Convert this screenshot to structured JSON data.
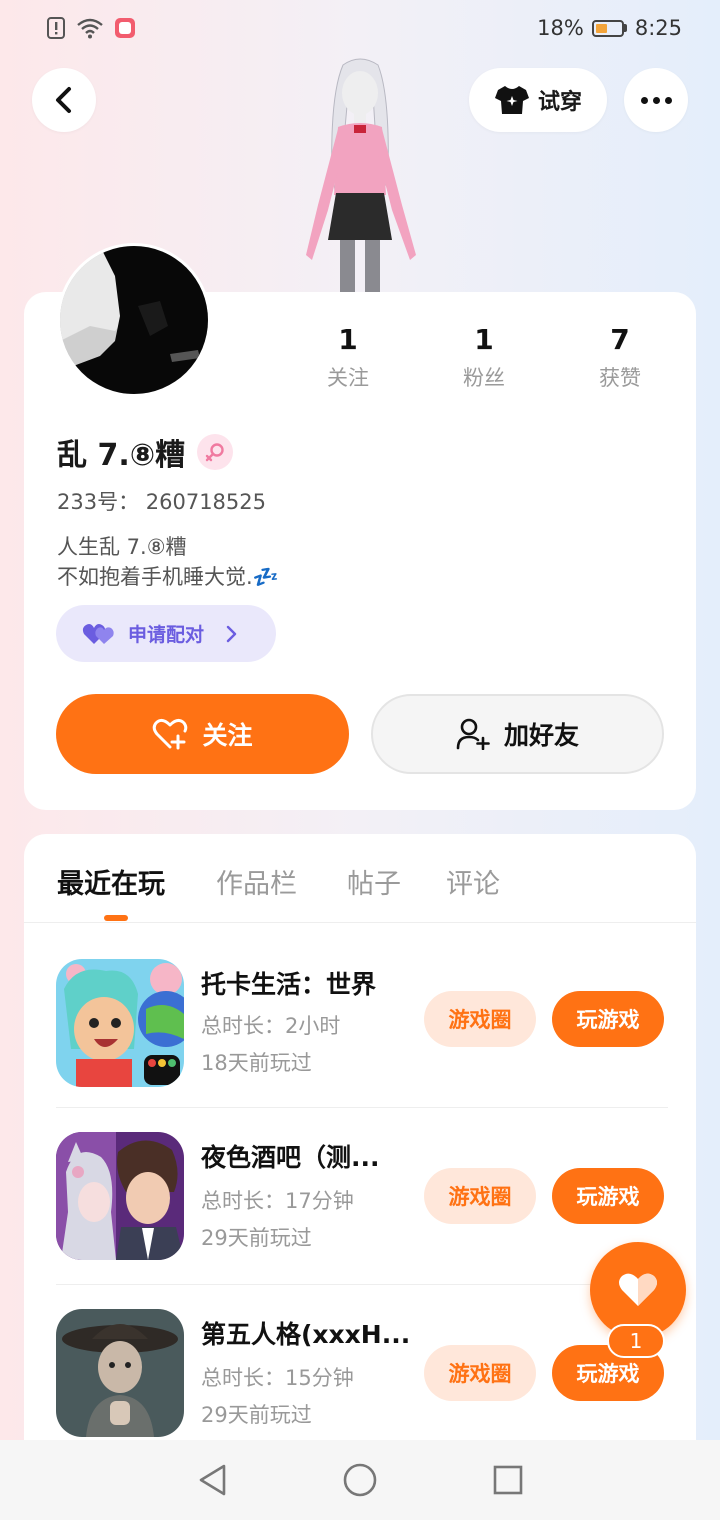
{
  "status": {
    "battery": "18%",
    "time": "8:25",
    "battery_level": 0.18
  },
  "header": {
    "try_on_label": "试穿"
  },
  "profile": {
    "stats": [
      {
        "value": "1",
        "label": "关注"
      },
      {
        "value": "1",
        "label": "粉丝"
      },
      {
        "value": "7",
        "label": "获赞"
      }
    ],
    "username": "乱 7.⑧糟",
    "uid": "233号：  260718525",
    "bio_line1": "人生乱 7.⑧糟",
    "bio_line2": "不如抱着手机睡大觉.💤",
    "pair_label": "申请配对",
    "follow_label": "关注",
    "add_friend_label": "加好友"
  },
  "tabs": [
    {
      "label": "最近在玩"
    },
    {
      "label": "作品栏"
    },
    {
      "label": "帖子"
    },
    {
      "label": "评论"
    }
  ],
  "games": [
    {
      "title": "托卡生活：世界",
      "duration": "总时长：2小时",
      "last_played": "18天前玩过",
      "circle_label": "游戏圈",
      "play_label": "玩游戏"
    },
    {
      "title": "夜色酒吧（测...",
      "duration": "总时长：17分钟",
      "last_played": "29天前玩过",
      "circle_label": "游戏圈",
      "play_label": "玩游戏"
    },
    {
      "title": "第五人格(xxxH...",
      "duration": "总时长：15分钟",
      "last_played": "29天前玩过",
      "circle_label": "游戏圈",
      "play_label": "玩游戏"
    }
  ],
  "fab": {
    "badge": "1"
  },
  "colors": {
    "accent": "#ff7214",
    "pair_bg": "#eae8fb",
    "pair_text": "#6b5de0"
  }
}
